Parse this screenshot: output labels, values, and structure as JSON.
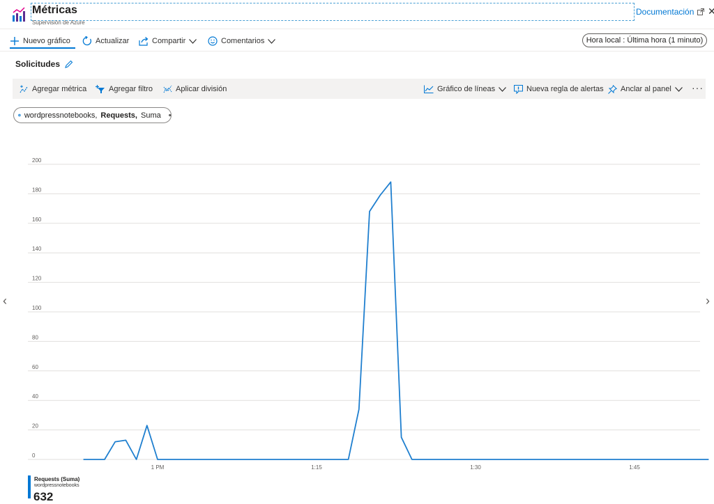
{
  "header": {
    "title": "Métricas",
    "subtitle": "Supervisión de Azure",
    "doc_link": "Documentación"
  },
  "toolbar": {
    "new_chart": "Nuevo gráfico",
    "refresh": "Actualizar",
    "share": "Compartir",
    "feedback": "Comentarios",
    "time_range": "Hora local : Última hora (1 minuto)"
  },
  "chart_title": "Solicitudes",
  "chart_toolbar": {
    "add_metric": "Agregar métrica",
    "add_filter": "Agregar filtro",
    "apply_split": "Aplicar división",
    "line_chart": "Gráfico de líneas",
    "new_alert": "Nueva regla de alertas",
    "pin": "Anclar al panel"
  },
  "metric_pill": {
    "resource": "wordpressnotebooks,",
    "metric": "Requests,",
    "aggregation": "Suma"
  },
  "legend": {
    "name": "Requests (Suma)",
    "resource": "wordpressnotebooks",
    "total": "632"
  },
  "colors": {
    "accent": "#0078d4",
    "line": "#1f7fcf"
  },
  "chart_data": {
    "type": "line",
    "ylim": [
      0,
      200
    ],
    "yticks": [
      "0",
      "20",
      "40",
      "60",
      "80",
      "100",
      "120",
      "140",
      "160",
      "180",
      "200"
    ],
    "x_minutes": [
      -7,
      -6,
      -5,
      -4,
      -3,
      -2,
      -1,
      0,
      1,
      2,
      3,
      4,
      5,
      6,
      7,
      8,
      9,
      10,
      11,
      12,
      13,
      14,
      15,
      16,
      17,
      18,
      19,
      20,
      21,
      22,
      23,
      24,
      25,
      26,
      27,
      28,
      29,
      30,
      31,
      32,
      33,
      34,
      35,
      36,
      37,
      38,
      39,
      40,
      41,
      42,
      43,
      44,
      45,
      46,
      47,
      48,
      49,
      50,
      51,
      52
    ],
    "xticks": [
      {
        "minute": 0,
        "label": "1 PM"
      },
      {
        "minute": 15,
        "label": "1:15"
      },
      {
        "minute": 30,
        "label": "1:30"
      },
      {
        "minute": 45,
        "label": "1:45"
      }
    ],
    "series": [
      {
        "name": "Requests (Suma)",
        "values": [
          0,
          0,
          0,
          12,
          13,
          0,
          23,
          0,
          0,
          0,
          0,
          0,
          0,
          0,
          0,
          0,
          0,
          0,
          0,
          0,
          0,
          0,
          0,
          0,
          0,
          0,
          34,
          168,
          179,
          188,
          15,
          0,
          0,
          0,
          0,
          0,
          0,
          0,
          0,
          0,
          0,
          0,
          0,
          0,
          0,
          0,
          0,
          0,
          0,
          0,
          0,
          0,
          0,
          0,
          0,
          0,
          0,
          0,
          0,
          0
        ]
      }
    ]
  }
}
